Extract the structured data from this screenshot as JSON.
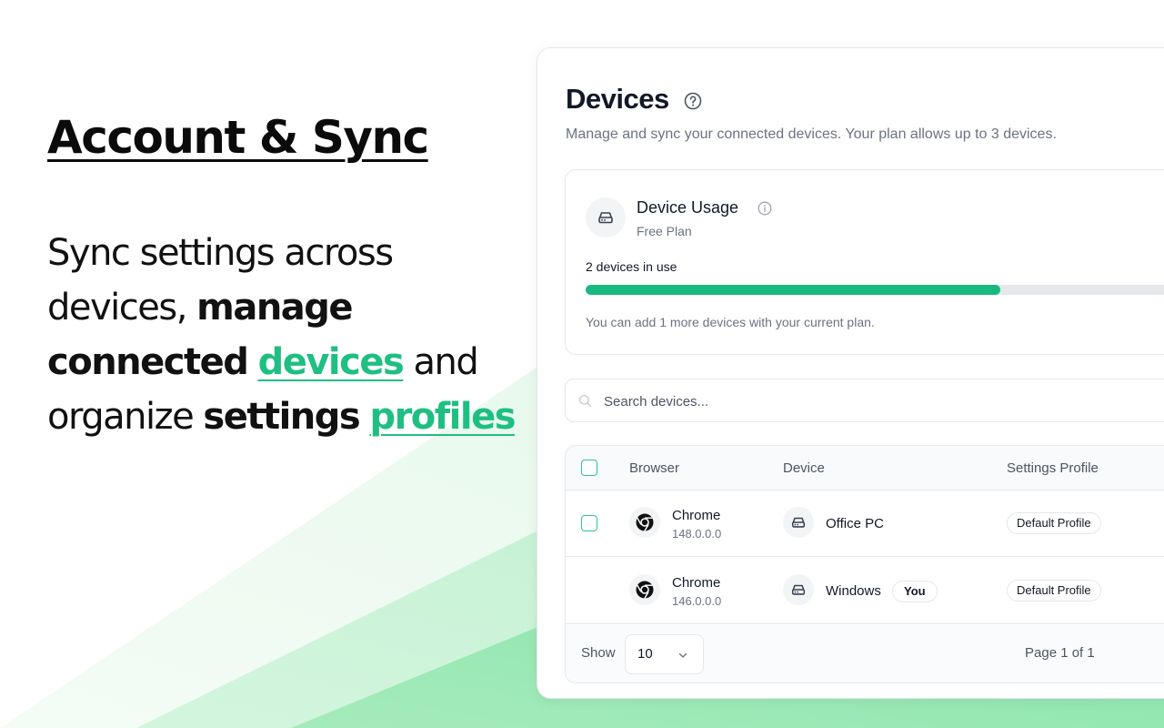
{
  "promo": {
    "title": "Account & Sync",
    "text1": "Sync settings across devices, ",
    "text2": "manage connected",
    "text3": "devices",
    "text4": " and organize ",
    "text5": "settings",
    "text6": "profiles"
  },
  "panel": {
    "title": "Devices",
    "subtitle": "Manage and sync your connected devices. Your plan allows up to 3 devices."
  },
  "usage": {
    "title": "Device Usage",
    "plan": "Free Plan",
    "count_label": "2 devices in use",
    "progress_fraction": 0.67,
    "note": "You can add 1 more devices with your current plan."
  },
  "search": {
    "placeholder": "Search devices..."
  },
  "table": {
    "headers": {
      "browser": "Browser",
      "device": "Device",
      "profile": "Settings Profile"
    },
    "rows": [
      {
        "browser": "Chrome",
        "version": "148.0.0.0",
        "device": "Office PC",
        "badge": "",
        "profile": "Default Profile",
        "selectable": true
      },
      {
        "browser": "Chrome",
        "version": "146.0.0.0",
        "device": "Windows",
        "badge": "You",
        "profile": "Default Profile",
        "selectable": false
      }
    ],
    "footer": {
      "show_label": "Show",
      "page_size": "10",
      "page_info": "Page 1 of 1"
    }
  },
  "colors": {
    "accent": "#18b97e",
    "accent_text": "#1fbf82",
    "background_green": "#86e8a8"
  },
  "icons": [
    "help-circle-icon",
    "drive-icon",
    "info-icon",
    "search-icon",
    "chrome-icon",
    "chevron-down-icon"
  ]
}
